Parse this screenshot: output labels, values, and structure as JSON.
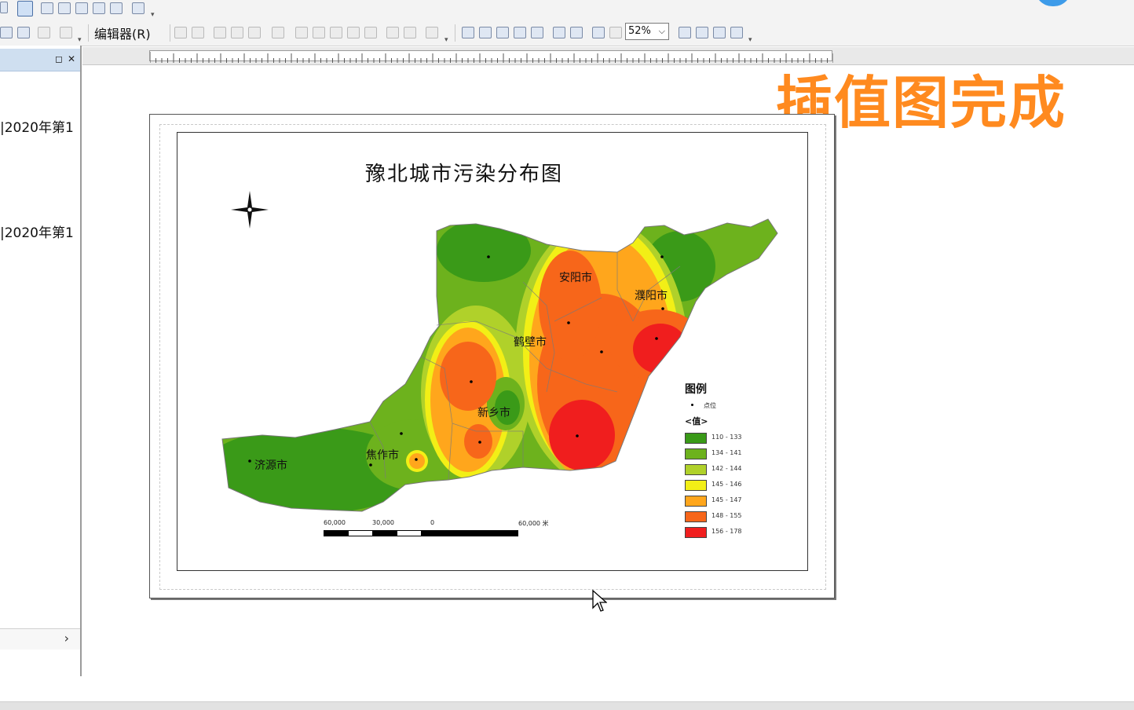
{
  "toolbar": {
    "editor_menu": "编辑器(R)",
    "zoom_value": "52%"
  },
  "left_panel": {
    "items": [
      {
        "label": "|2020年第1"
      },
      {
        "label": "|2020年第1"
      }
    ]
  },
  "overlay": {
    "caption": "插值图完成"
  },
  "map": {
    "title": "豫北城市污染分布图",
    "cities": [
      {
        "name": "安阳市"
      },
      {
        "name": "濮阳市"
      },
      {
        "name": "鹤壁市"
      },
      {
        "name": "新乡市"
      },
      {
        "name": "焦作市"
      },
      {
        "name": "济源市"
      }
    ],
    "legend": {
      "title": "图例",
      "point_label": "点位",
      "value_label": "<值>",
      "classes": [
        {
          "range": "110 - 133",
          "color": "#3a9a18"
        },
        {
          "range": "134 - 141",
          "color": "#6db21d"
        },
        {
          "range": "142 - 144",
          "color": "#b0d12a"
        },
        {
          "range": "145 - 146",
          "color": "#f2ef16"
        },
        {
          "range": "145 - 147",
          "color": "#ffa61c"
        },
        {
          "range": "148 - 155",
          "color": "#f7661a"
        },
        {
          "range": "156 - 178",
          "color": "#f01e1e"
        }
      ]
    },
    "scale": {
      "labels": [
        "60,000",
        "30,000",
        "0",
        "60,000 米"
      ]
    }
  }
}
